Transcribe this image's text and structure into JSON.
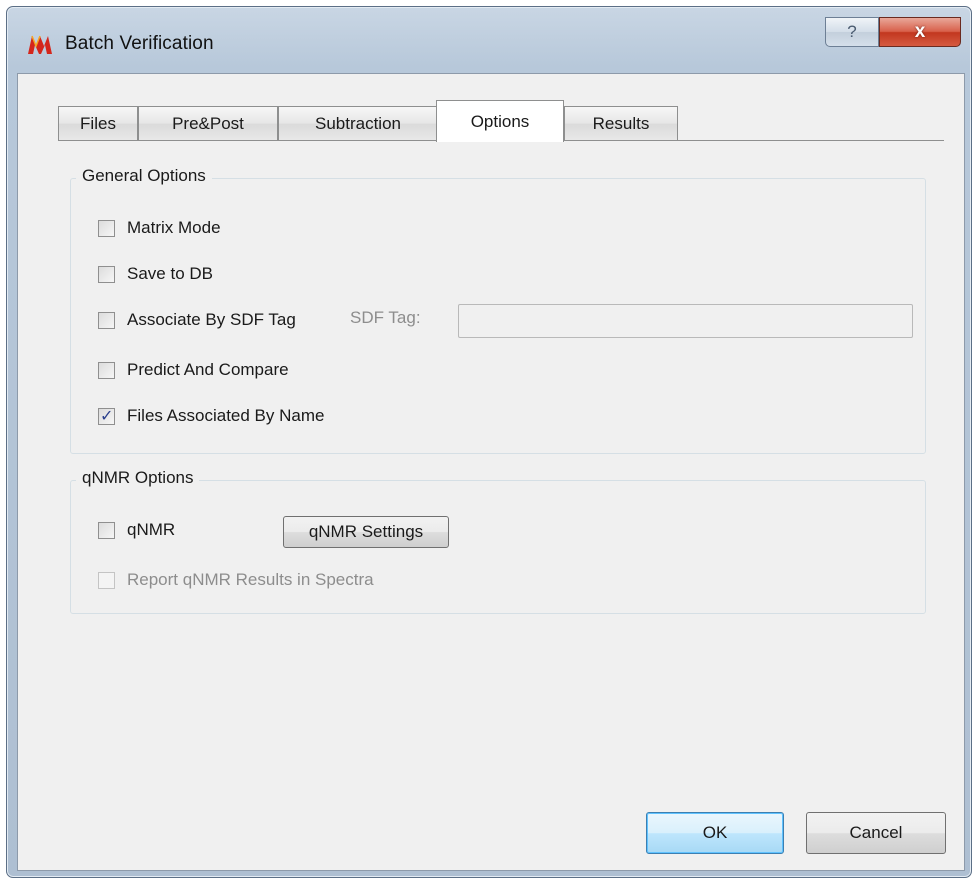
{
  "window": {
    "title": "Batch Verification",
    "help_label": "?",
    "close_label": "x"
  },
  "tabs": [
    {
      "label": "Files",
      "active": false
    },
    {
      "label": "Pre&Post",
      "active": false
    },
    {
      "label": "Subtraction",
      "active": false
    },
    {
      "label": "Options",
      "active": true
    },
    {
      "label": "Results",
      "active": false
    }
  ],
  "general_options": {
    "title": "General Options",
    "matrix_mode": {
      "label": "Matrix Mode",
      "checked": false
    },
    "save_to_db": {
      "label": "Save to DB",
      "checked": false
    },
    "associate_by_sdf": {
      "label": "Associate By SDF Tag",
      "checked": false
    },
    "sdf_tag_label": "SDF Tag:",
    "sdf_tag_value": "",
    "predict_and_compare": {
      "label": "Predict And Compare",
      "checked": false
    },
    "files_associated_by_name": {
      "label": "Files Associated By Name",
      "checked": true
    }
  },
  "qnmr_options": {
    "title": "qNMR Options",
    "qnmr": {
      "label": "qNMR",
      "checked": false
    },
    "settings_button": "qNMR Settings",
    "report_results": {
      "label": "Report qNMR Results in Spectra",
      "checked": false,
      "disabled": true
    }
  },
  "footer": {
    "ok_label": "OK",
    "cancel_label": "Cancel"
  },
  "colors": {
    "title_bar": "#b7c8da",
    "close_button": "#c2371f",
    "dialog_background": "#f0f0f0",
    "default_button": "#bee6fd",
    "check_mark": "#2a3f8c"
  }
}
